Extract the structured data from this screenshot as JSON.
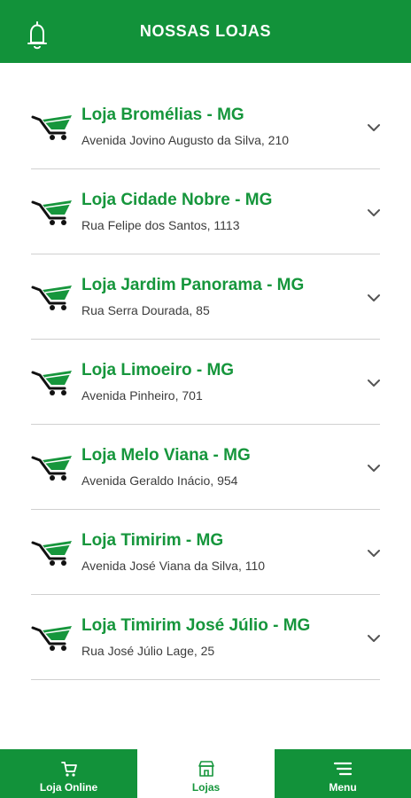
{
  "header": {
    "title": "NOSSAS LOJAS",
    "bell_icon": "bell-icon"
  },
  "stores": [
    {
      "name": "Loja Bromélias - MG",
      "address": "Avenida Jovino Augusto da Silva, 210"
    },
    {
      "name": "Loja Cidade Nobre - MG",
      "address": "Rua Felipe dos Santos, 1113"
    },
    {
      "name": "Loja Jardim Panorama - MG",
      "address": "Rua Serra Dourada, 85"
    },
    {
      "name": "Loja Limoeiro - MG",
      "address": "Avenida Pinheiro, 701"
    },
    {
      "name": "Loja Melo Viana - MG",
      "address": "Avenida Geraldo Inácio, 954"
    },
    {
      "name": "Loja Timirim - MG",
      "address": "Avenida José Viana da Silva, 110"
    },
    {
      "name": "Loja Timirim José Júlio - MG",
      "address": "Rua José Júlio Lage, 25"
    }
  ],
  "bottom_nav": {
    "items": [
      {
        "label": "Loja Online",
        "icon": "cart-icon",
        "active": false
      },
      {
        "label": "Lojas",
        "icon": "store-icon",
        "active": true
      },
      {
        "label": "Menu",
        "icon": "menu-icon",
        "active": false
      }
    ]
  },
  "colors": {
    "brand_green": "#12923a",
    "store_name": "#16963c",
    "address_text": "#3c3c3c",
    "divider": "#d0d0d0"
  }
}
